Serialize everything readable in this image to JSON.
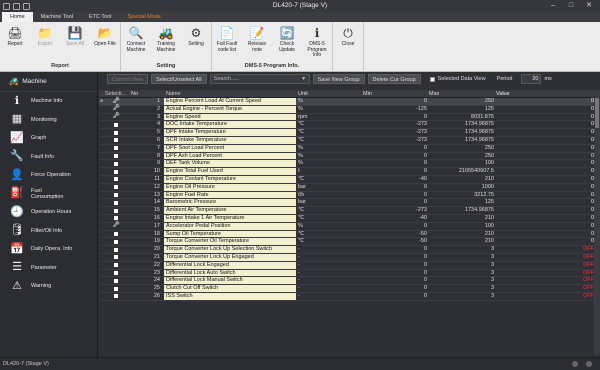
{
  "window": {
    "title": "DL420-7 (Stage V)"
  },
  "tabs": [
    "Home",
    "Machine Tool",
    "ETC Tool",
    "Special Mode"
  ],
  "ribbon": {
    "groups": [
      {
        "label": "Report",
        "buttons": [
          {
            "label": "Report",
            "icon": "report-icon",
            "glyph": "🖨"
          },
          {
            "label": "Export",
            "icon": "export-icon",
            "glyph": "📁",
            "disabled": true
          },
          {
            "label": "Save All",
            "icon": "save-all-icon",
            "glyph": "💾",
            "disabled": true
          },
          {
            "label": "Open File",
            "icon": "open-file-icon",
            "glyph": "📂"
          }
        ]
      },
      {
        "label": "Setting",
        "buttons": [
          {
            "label": "Connect\nMachine",
            "icon": "connect-icon",
            "glyph": "🔍"
          },
          {
            "label": "Training\nMachine",
            "icon": "training-icon",
            "glyph": "🚜"
          },
          {
            "label": "Setting",
            "icon": "gear-icon",
            "glyph": "⚙"
          }
        ]
      },
      {
        "label": "DMS-5 Program Info.",
        "buttons": [
          {
            "label": "Full Fault\ncode list",
            "icon": "fault-list-icon",
            "glyph": "📄"
          },
          {
            "label": "Release\nnote",
            "icon": "release-note-icon",
            "glyph": "📝"
          },
          {
            "label": "Check\nUpdate",
            "icon": "check-update-icon",
            "glyph": "🔄"
          },
          {
            "label": "DMS-5 Program\nInfo",
            "icon": "info-icon",
            "glyph": "ℹ"
          }
        ]
      },
      {
        "label": "",
        "buttons": [
          {
            "label": "Close",
            "icon": "close-icon",
            "glyph": "⏻"
          }
        ]
      }
    ]
  },
  "sidebar": {
    "header": "Machine",
    "items": [
      {
        "label": "Machine Info",
        "icon": "info-icon",
        "glyph": "ℹ"
      },
      {
        "label": "Monitoring",
        "icon": "monitoring-icon",
        "glyph": "▦"
      },
      {
        "label": "Graph",
        "icon": "graph-icon",
        "glyph": "📈"
      },
      {
        "label": "Fault Info",
        "icon": "fault-icon",
        "glyph": "🔧"
      },
      {
        "label": "Force Operation",
        "icon": "force-operation-icon",
        "glyph": "👤"
      },
      {
        "label": "Fuel\nConsumption",
        "icon": "fuel-icon",
        "glyph": "⛽"
      },
      {
        "label": "Operation Hours",
        "icon": "clock-icon",
        "glyph": "🕘"
      },
      {
        "label": "Filter/Oil Info",
        "icon": "filter-icon",
        "glyph": "🛢"
      },
      {
        "label": "Daily Opera. Info",
        "icon": "calendar-icon",
        "glyph": "📅"
      },
      {
        "label": "Parameter",
        "icon": "parameter-icon",
        "glyph": "☰"
      },
      {
        "label": "Warning",
        "icon": "warning-icon",
        "glyph": "⚠"
      }
    ]
  },
  "toolbar": {
    "control_view": "Control View",
    "select_all": "Select/Unselect All",
    "search_placeholder": "Search.....",
    "save_new_group": "Save New Group",
    "delete_group": "Delete Cur Group",
    "selected_data_view": "Selected Data View",
    "period_label": "Period",
    "period_value": "20",
    "period_unit": "ms"
  },
  "grid": {
    "columns": [
      "Selecti...",
      "No",
      "Name",
      "Unit",
      "Min",
      "Max",
      "Value"
    ],
    "rows": [
      {
        "no": "1",
        "name": "Engine Percent Load At Current Speed",
        "unit": "%",
        "min": "0",
        "max": "250",
        "value": "0",
        "mark": "key",
        "selected": true
      },
      {
        "no": "2",
        "name": "Actual Engine - Percent Torque",
        "unit": "%",
        "min": "-125",
        "max": "125",
        "value": "0",
        "mark": "key"
      },
      {
        "no": "3",
        "name": "Engine Speed",
        "unit": "rpm",
        "min": "0",
        "max": "8031.875",
        "value": "0",
        "mark": "key"
      },
      {
        "no": "4",
        "name": "DOC Intake Temperature",
        "unit": "℃",
        "min": "-273",
        "max": "1734.96875",
        "value": "0"
      },
      {
        "no": "5",
        "name": "DPF Intake Temperature",
        "unit": "℃",
        "min": "-273",
        "max": "1734.96875",
        "value": "0"
      },
      {
        "no": "6",
        "name": "SCR Intake Temperature",
        "unit": "℃",
        "min": "-273",
        "max": "1734.96875",
        "value": "0"
      },
      {
        "no": "7",
        "name": "DPF Soot Load Percent",
        "unit": "%",
        "min": "0",
        "max": "250",
        "value": "0"
      },
      {
        "no": "8",
        "name": "DPF Ash Load Percent",
        "unit": "%",
        "min": "0",
        "max": "250",
        "value": "0"
      },
      {
        "no": "9",
        "name": "DEF Tank Volume",
        "unit": "%",
        "min": "0",
        "max": "100",
        "value": "0"
      },
      {
        "no": "10",
        "name": "Engine Total Fuel Used",
        "unit": "ℓ",
        "min": "0",
        "max": "2105540607.5",
        "value": "0"
      },
      {
        "no": "11",
        "name": "Engine Coolant Temperature",
        "unit": "℃",
        "min": "-40",
        "max": "210",
        "value": "0"
      },
      {
        "no": "12",
        "name": "Engine Oil Pressure",
        "unit": "bar",
        "min": "0",
        "max": "1000",
        "value": "0"
      },
      {
        "no": "13",
        "name": "Engine Fuel Rate",
        "unit": "ℓ/h",
        "min": "0",
        "max": "3212.75",
        "value": "0"
      },
      {
        "no": "14",
        "name": "Barometric Pressure",
        "unit": "bar",
        "min": "0",
        "max": "125",
        "value": "0"
      },
      {
        "no": "15",
        "name": "Ambient Air Temperature",
        "unit": "℃",
        "min": "-273",
        "max": "1734.96875",
        "value": "0"
      },
      {
        "no": "16",
        "name": "Engine Intake 1 Air Temperature",
        "unit": "℃",
        "min": "-40",
        "max": "210",
        "value": "0"
      },
      {
        "no": "17",
        "name": "Accelerator Pedal Position",
        "unit": "%",
        "min": "0",
        "max": "100",
        "value": "0",
        "mark": "key"
      },
      {
        "no": "18",
        "name": "Sump Oil Temperature",
        "unit": "℃",
        "min": "-50",
        "max": "210",
        "value": "0"
      },
      {
        "no": "19",
        "name": "Torque Converter Oil Temperature",
        "unit": "℃",
        "min": "-50",
        "max": "210",
        "value": "0"
      },
      {
        "no": "20",
        "name": "Torque Converter Lock Up Selection Switch",
        "unit": "-",
        "min": "0",
        "max": "3",
        "value": "OFF",
        "red": true
      },
      {
        "no": "21",
        "name": "Torque Converter Lock Up Engaged",
        "unit": "-",
        "min": "0",
        "max": "3",
        "value": "OFF",
        "red": true
      },
      {
        "no": "22",
        "name": "Differential Lock Engaged",
        "unit": "-",
        "min": "0",
        "max": "3",
        "value": "OFF",
        "red": true
      },
      {
        "no": "23",
        "name": "Differential Lock Auto Switch",
        "unit": "-",
        "min": "0",
        "max": "3",
        "value": "OFF",
        "red": true
      },
      {
        "no": "24",
        "name": "Differential Lock Manual Switch",
        "unit": "-",
        "min": "0",
        "max": "3",
        "value": "OFF",
        "red": true
      },
      {
        "no": "25",
        "name": "Clutch Cut Off Switch",
        "unit": "-",
        "min": "0",
        "max": "3",
        "value": "OFF",
        "red": true
      },
      {
        "no": "26",
        "name": "ISS Switch",
        "unit": "-",
        "min": "0",
        "max": "3",
        "value": "OFF",
        "red": true
      }
    ]
  },
  "status": {
    "text": "DL420-7 (Stage V)"
  },
  "colors": {
    "accent": "#f07e1c",
    "name_cell": "#f3f0cf",
    "off_value": "#ff2c2c"
  }
}
